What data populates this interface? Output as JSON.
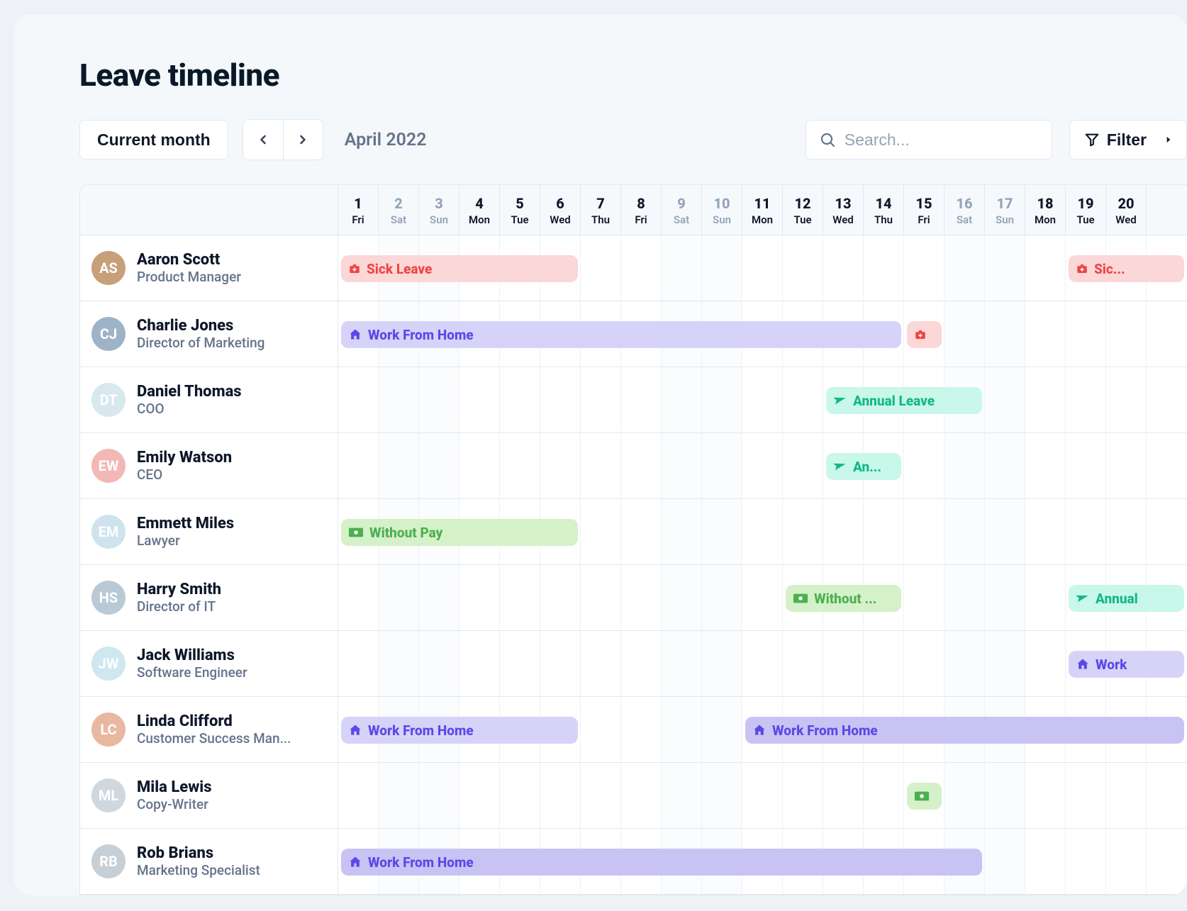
{
  "page": {
    "title": "Leave timeline"
  },
  "toolbar": {
    "current_month_label": "Current month",
    "month_label": "April 2022",
    "search_placeholder": "Search...",
    "filter_label": "Filter"
  },
  "colors": {
    "sick_bg": "#fbd7d7",
    "sick_fg": "#ef4444",
    "wfh_bg": "#d7d3f8",
    "wfh_fg": "#5b48e8",
    "annual_bg": "#c9f7ea",
    "annual_fg": "#10b981",
    "nopay_bg": "#d5f1c9",
    "nopay_fg": "#4caf50"
  },
  "days": [
    {
      "num": "1",
      "name": "Fri",
      "weekend": false
    },
    {
      "num": "2",
      "name": "Sat",
      "weekend": true
    },
    {
      "num": "3",
      "name": "Sun",
      "weekend": true
    },
    {
      "num": "4",
      "name": "Mon",
      "weekend": false
    },
    {
      "num": "5",
      "name": "Tue",
      "weekend": false
    },
    {
      "num": "6",
      "name": "Wed",
      "weekend": false
    },
    {
      "num": "7",
      "name": "Thu",
      "weekend": false
    },
    {
      "num": "8",
      "name": "Fri",
      "weekend": false
    },
    {
      "num": "9",
      "name": "Sat",
      "weekend": true
    },
    {
      "num": "10",
      "name": "Sun",
      "weekend": true
    },
    {
      "num": "11",
      "name": "Mon",
      "weekend": false
    },
    {
      "num": "12",
      "name": "Tue",
      "weekend": false
    },
    {
      "num": "13",
      "name": "Wed",
      "weekend": false
    },
    {
      "num": "14",
      "name": "Thu",
      "weekend": false
    },
    {
      "num": "15",
      "name": "Fri",
      "weekend": false
    },
    {
      "num": "16",
      "name": "Sat",
      "weekend": true
    },
    {
      "num": "17",
      "name": "Sun",
      "weekend": true
    },
    {
      "num": "18",
      "name": "Mon",
      "weekend": false
    },
    {
      "num": "19",
      "name": "Tue",
      "weekend": false
    },
    {
      "num": "20",
      "name": "Wed",
      "weekend": false
    }
  ],
  "employees": [
    {
      "name": "Aaron Scott",
      "role": "Product Manager",
      "avatar_bg": "#c7a07a",
      "leaves": [
        {
          "type": "sick",
          "icon": "medkit",
          "label": "Sick Leave",
          "start": 1,
          "end": 6
        },
        {
          "type": "sick",
          "icon": "medkit",
          "label": "Sic...",
          "start": 19,
          "end": 21
        }
      ]
    },
    {
      "name": "Charlie Jones",
      "role": "Director of Marketing",
      "avatar_bg": "#9fb3c8",
      "leaves": [
        {
          "type": "wfh",
          "icon": "home",
          "label": "Work From Home",
          "start": 1,
          "end": 14
        },
        {
          "type": "sick-mini",
          "icon": "medkit",
          "label": "",
          "start": 15,
          "end": 15
        }
      ]
    },
    {
      "name": "Daniel Thomas",
      "role": "COO",
      "avatar_bg": "#d9e7ef",
      "leaves": [
        {
          "type": "annual",
          "icon": "plane",
          "label": "Annual Leave",
          "start": 13,
          "end": 16
        }
      ]
    },
    {
      "name": "Emily Watson",
      "role": "CEO",
      "avatar_bg": "#f2b8b5",
      "leaves": [
        {
          "type": "annual",
          "icon": "plane",
          "label": "An...",
          "start": 13,
          "end": 14
        }
      ]
    },
    {
      "name": "Emmett Miles",
      "role": "Lawyer",
      "avatar_bg": "#cfe3ef",
      "leaves": [
        {
          "type": "nopay",
          "icon": "cash",
          "label": "Without Pay",
          "start": 1,
          "end": 6
        }
      ]
    },
    {
      "name": "Harry Smith",
      "role": "Director of IT",
      "avatar_bg": "#b9c9d6",
      "leaves": [
        {
          "type": "nopay",
          "icon": "cash",
          "label": "Without ...",
          "start": 12,
          "end": 14
        },
        {
          "type": "annual",
          "icon": "plane",
          "label": "Annual",
          "start": 19,
          "end": 21
        }
      ]
    },
    {
      "name": "Jack Williams",
      "role": "Software Engineer",
      "avatar_bg": "#cfe7ef",
      "leaves": [
        {
          "type": "wfh",
          "icon": "home",
          "label": "Work",
          "start": 19,
          "end": 21
        }
      ]
    },
    {
      "name": "Linda Clifford",
      "role": "Customer Success Man...",
      "avatar_bg": "#e8b8a0",
      "leaves": [
        {
          "type": "wfh",
          "icon": "home",
          "label": "Work From Home",
          "start": 1,
          "end": 6
        },
        {
          "type": "wfh2",
          "icon": "home",
          "label": "Work From Home",
          "start": 11,
          "end": 21
        }
      ]
    },
    {
      "name": "Mila Lewis",
      "role": "Copy-Writer",
      "avatar_bg": "#d0d8de",
      "leaves": [
        {
          "type": "nopay-mini",
          "icon": "cash",
          "label": "",
          "start": 15,
          "end": 15
        }
      ]
    },
    {
      "name": "Rob Brians",
      "role": "Marketing Specialist",
      "avatar_bg": "#c7cfd6",
      "leaves": [
        {
          "type": "wfh2",
          "icon": "home",
          "label": "Work From Home",
          "start": 1,
          "end": 16
        }
      ]
    }
  ]
}
